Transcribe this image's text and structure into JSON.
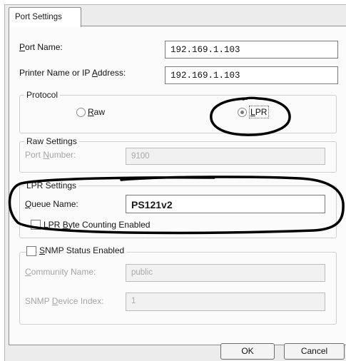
{
  "tab": {
    "label": "Port Settings"
  },
  "port_name": {
    "label_pre": "",
    "label_accel": "P",
    "label_post": "ort Name:",
    "value": "192.169.1.103"
  },
  "printer_name": {
    "label_pre": "Printer Name or IP ",
    "label_accel": "A",
    "label_post": "ddress:",
    "value": "192.169.1.103"
  },
  "protocol": {
    "title": "Protocol",
    "raw": {
      "label_accel": "R",
      "label_post": "aw",
      "selected": false
    },
    "lpr": {
      "label_accel": "L",
      "label_post": "PR",
      "selected": true
    }
  },
  "raw_settings": {
    "title": "Raw Settings",
    "port_number": {
      "label_pre": "Port ",
      "label_accel": "N",
      "label_post": "umber:",
      "value": "9100"
    }
  },
  "lpr_settings": {
    "title": "LPR Settings",
    "queue_name": {
      "label_accel": "Q",
      "label_post": "ueue Name:",
      "value": "PS121v2"
    },
    "byte_counting": {
      "label_pre": "LPR ",
      "label_accel": "B",
      "label_post": "yte Counting Enabled",
      "checked": false
    }
  },
  "snmp": {
    "status": {
      "label_accel": "S",
      "label_post": "NMP Status Enabled",
      "checked": false
    },
    "community": {
      "label_pre": "",
      "label_accel": "C",
      "label_post": "ommunity Name:",
      "value": "public"
    },
    "device_index": {
      "label_pre": "SNMP ",
      "label_accel": "D",
      "label_post": "evice Index:",
      "value": "1"
    }
  },
  "buttons": {
    "ok": "OK",
    "cancel": "Cancel"
  },
  "colors": {
    "annotation": "#000000",
    "window_bg": "#ececec",
    "panel_bg": "#fbfbfb"
  }
}
